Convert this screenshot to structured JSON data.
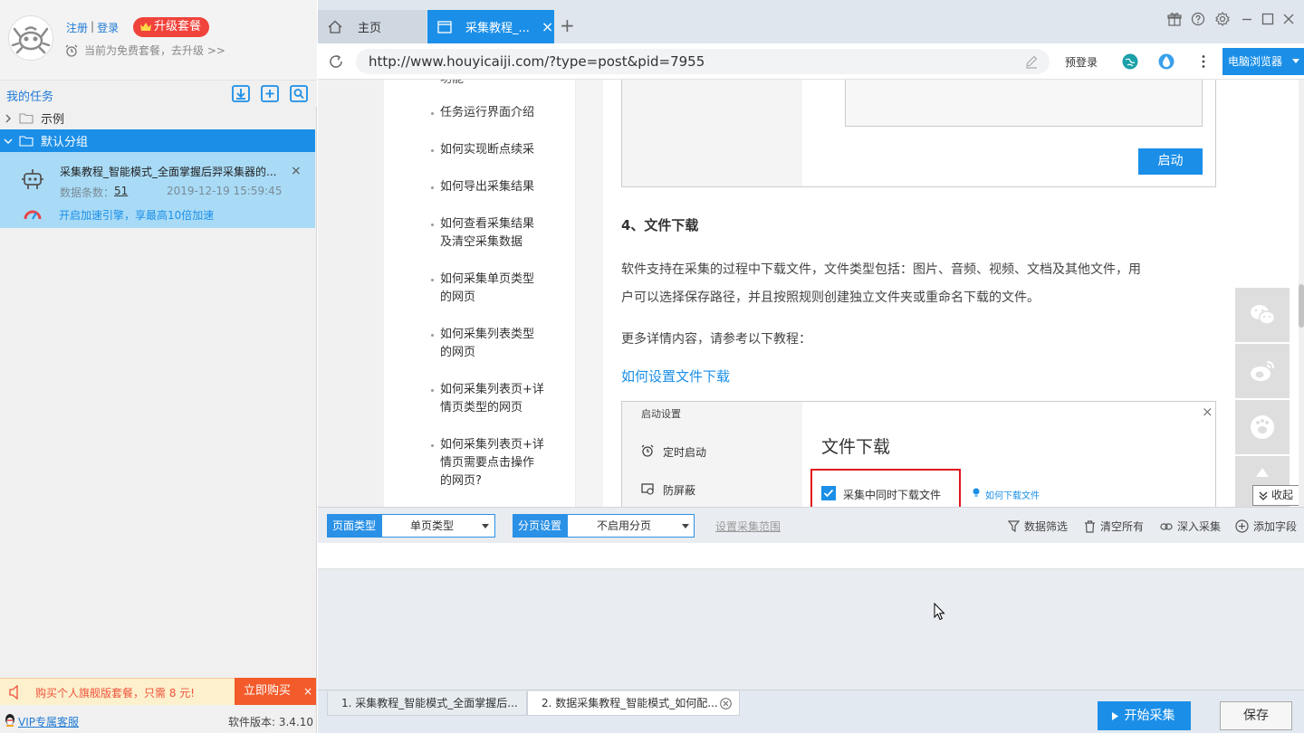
{
  "user": {
    "register_label": "注册",
    "separator": "|",
    "login_label": "登录",
    "upgrade_label": "升级套餐",
    "plan_status": "当前为免费套餐，去升级 >>"
  },
  "tasks": {
    "header": "我的任务",
    "groups": [
      {
        "label": "示例"
      },
      {
        "label": "默认分组"
      }
    ],
    "task": {
      "title": "采集教程_智能模式_全面掌握后羿采集器的...",
      "count_label": "数据条数：",
      "count_value": "51",
      "timestamp": "2019-12-19 15:59:45",
      "accelerate": "开启加速引擎，享最高10倍加速"
    }
  },
  "promo": {
    "text": "购买个人旗舰版套餐，只需 8 元!",
    "buy_label": "立即购买",
    "close": "×"
  },
  "footer": {
    "support": "VIP专属客服",
    "version": "软件版本: 3.4.10"
  },
  "tabs": {
    "home": "主页",
    "active": "采集教程_...",
    "close": "×",
    "add": "+"
  },
  "address": {
    "url": "http://www.houyicaiji.com/?type=post&pid=7955",
    "prelogin": "预登录",
    "browser_btn": "电脑浏览器"
  },
  "toc": {
    "top_fragment": "功能",
    "items": [
      [
        "任务运行界面介绍"
      ],
      [
        "如何实现断点续采"
      ],
      [
        "如何导出采集结果"
      ],
      [
        "如何查看采集结果",
        "及清空采集数据"
      ],
      [
        "如何采集单页类型",
        "的网页"
      ],
      [
        "如何采集列表类型",
        "的网页"
      ],
      [
        "如何采集列表页+详",
        "情页类型的网页"
      ],
      [
        "如何采集列表页+详",
        "情页需要点击操作",
        "的网页?"
      ]
    ]
  },
  "article": {
    "start_btn": "启动",
    "heading": "4、文件下载",
    "para1_line1": "软件支持在采集的过程中下载文件，文件类型包括：图片、音频、视频、文档及其他文件，用",
    "para1_line2": "户可以选择保存路径，并且按照规则创建独立文件夹或重命名下载的文件。",
    "para2": "更多详情内容，请参考以下教程：",
    "link": "如何设置文件下载",
    "shot": {
      "sidebar_title": "启动设置",
      "menu1": "定时启动",
      "menu2": "防屏蔽",
      "title": "文件下载",
      "checkbox": "采集中同时下载文件",
      "help": "如何下载文件"
    },
    "collapse": "收起"
  },
  "toolbar": {
    "page_type_label": "页面类型",
    "page_type_value": "单页类型",
    "paging_label": "分页设置",
    "paging_value": "不启用分页",
    "range": "设置采集范围",
    "filter": "数据筛选",
    "clear": "清空所有",
    "deep": "深入采集",
    "add_field": "添加字段"
  },
  "bottom": {
    "tab1": "1. 采集教程_智能模式_全面掌握后...",
    "tab2": "2. 数据采集教程_智能模式_如何配...",
    "start": "开始采集",
    "save": "保存"
  },
  "colors": {
    "accent": "#1b8fe8",
    "upgrade": "#f0433b",
    "task_bg": "#a9dbf6",
    "promo_bg": "#fdf0cd",
    "buy": "#f35b2a"
  }
}
